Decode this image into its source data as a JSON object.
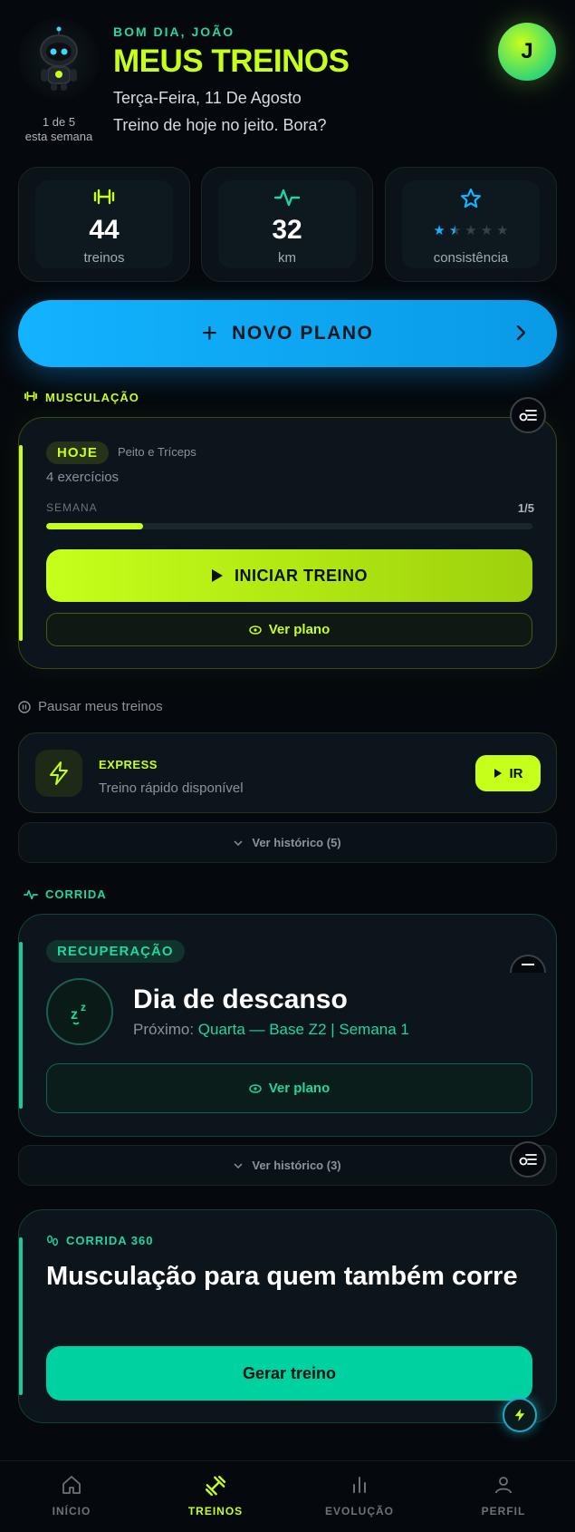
{
  "header": {
    "greeting": "BOM DIA, JOÃO",
    "title": "MEUS TREINOS",
    "date": "Terça-Feira, 11 De Agosto",
    "tagline": "Treino de hoje no jeito. Bora?",
    "mascot_count_line1": "1 de 5",
    "mascot_count_line2": "esta semana",
    "avatar_initial": "J"
  },
  "stats": [
    {
      "value": "44",
      "label": "treinos",
      "icon": "dumbbell-icon"
    },
    {
      "value": "32",
      "label": "km",
      "icon": "activity-icon"
    },
    {
      "value": "",
      "label": "consistência",
      "icon": "star-icon",
      "rating": 1.5,
      "max": 5
    }
  ],
  "new_plan": {
    "label": "NOVO PLANO",
    "plus": "+"
  },
  "musculacao": {
    "section_label": "MUSCULAÇÃO",
    "pill": "HOJE",
    "workout_name": "Peito e Tríceps",
    "exercises": "4 exercícios",
    "week_label": "SEMANA",
    "week_progress": "1/5",
    "progress_fraction": 0.2,
    "start_label": "INICIAR TREINO",
    "view_plan_label": "Ver plano"
  },
  "pause_label": "Pausar meus treinos",
  "express": {
    "title": "EXPRESS",
    "subtitle": "Treino rápido disponível",
    "go_label": "IR"
  },
  "history_musculacao": "Ver histórico (5)",
  "corrida": {
    "section_label": "CORRIDA",
    "pill": "RECUPERAÇÃO",
    "zz": "zᶻ",
    "title": "Dia de descanso",
    "next_prefix": "Próximo: ",
    "next_value": "Quarta — Base Z2 | Semana 1",
    "view_plan_label": "Ver plano"
  },
  "history_corrida": "Ver histórico (3)",
  "corrida360": {
    "tag": "CORRIDA 360",
    "title": "Musculação para quem também corre",
    "button": "Gerar treino"
  },
  "nav": [
    {
      "label": "INÍCIO",
      "icon": "home-icon",
      "active": false
    },
    {
      "label": "TREINOS",
      "icon": "dumbbell-icon",
      "active": true
    },
    {
      "label": "EVOLUÇÃO",
      "icon": "bar-chart-icon",
      "active": false
    },
    {
      "label": "PERFIL",
      "icon": "user-icon",
      "active": false
    }
  ],
  "colors": {
    "accent_lime": "#c6ff1a",
    "accent_teal": "#1fd6a2",
    "accent_blue": "#12b3ff",
    "background": "#05090d"
  }
}
